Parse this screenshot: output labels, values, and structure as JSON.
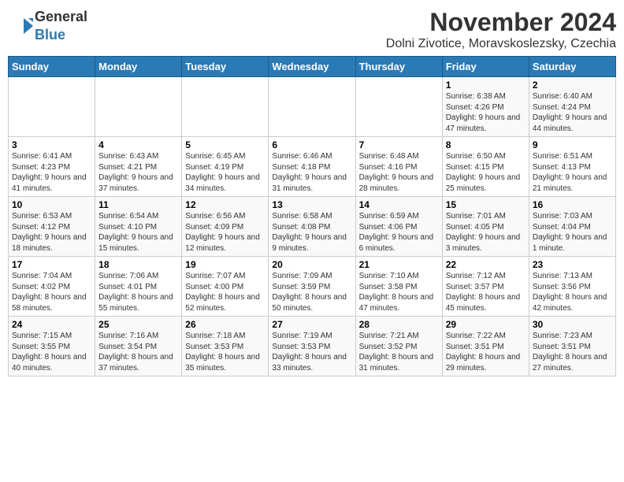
{
  "header": {
    "logo_general": "General",
    "logo_blue": "Blue",
    "title": "November 2024",
    "subtitle": "Dolni Zivotice, Moravskoslezsky, Czechia"
  },
  "days_of_week": [
    "Sunday",
    "Monday",
    "Tuesday",
    "Wednesday",
    "Thursday",
    "Friday",
    "Saturday"
  ],
  "weeks": [
    [
      {
        "day": "",
        "info": ""
      },
      {
        "day": "",
        "info": ""
      },
      {
        "day": "",
        "info": ""
      },
      {
        "day": "",
        "info": ""
      },
      {
        "day": "",
        "info": ""
      },
      {
        "day": "1",
        "info": "Sunrise: 6:38 AM\nSunset: 4:26 PM\nDaylight: 9 hours and 47 minutes."
      },
      {
        "day": "2",
        "info": "Sunrise: 6:40 AM\nSunset: 4:24 PM\nDaylight: 9 hours and 44 minutes."
      }
    ],
    [
      {
        "day": "3",
        "info": "Sunrise: 6:41 AM\nSunset: 4:23 PM\nDaylight: 9 hours and 41 minutes."
      },
      {
        "day": "4",
        "info": "Sunrise: 6:43 AM\nSunset: 4:21 PM\nDaylight: 9 hours and 37 minutes."
      },
      {
        "day": "5",
        "info": "Sunrise: 6:45 AM\nSunset: 4:19 PM\nDaylight: 9 hours and 34 minutes."
      },
      {
        "day": "6",
        "info": "Sunrise: 6:46 AM\nSunset: 4:18 PM\nDaylight: 9 hours and 31 minutes."
      },
      {
        "day": "7",
        "info": "Sunrise: 6:48 AM\nSunset: 4:16 PM\nDaylight: 9 hours and 28 minutes."
      },
      {
        "day": "8",
        "info": "Sunrise: 6:50 AM\nSunset: 4:15 PM\nDaylight: 9 hours and 25 minutes."
      },
      {
        "day": "9",
        "info": "Sunrise: 6:51 AM\nSunset: 4:13 PM\nDaylight: 9 hours and 21 minutes."
      }
    ],
    [
      {
        "day": "10",
        "info": "Sunrise: 6:53 AM\nSunset: 4:12 PM\nDaylight: 9 hours and 18 minutes."
      },
      {
        "day": "11",
        "info": "Sunrise: 6:54 AM\nSunset: 4:10 PM\nDaylight: 9 hours and 15 minutes."
      },
      {
        "day": "12",
        "info": "Sunrise: 6:56 AM\nSunset: 4:09 PM\nDaylight: 9 hours and 12 minutes."
      },
      {
        "day": "13",
        "info": "Sunrise: 6:58 AM\nSunset: 4:08 PM\nDaylight: 9 hours and 9 minutes."
      },
      {
        "day": "14",
        "info": "Sunrise: 6:59 AM\nSunset: 4:06 PM\nDaylight: 9 hours and 6 minutes."
      },
      {
        "day": "15",
        "info": "Sunrise: 7:01 AM\nSunset: 4:05 PM\nDaylight: 9 hours and 3 minutes."
      },
      {
        "day": "16",
        "info": "Sunrise: 7:03 AM\nSunset: 4:04 PM\nDaylight: 9 hours and 1 minute."
      }
    ],
    [
      {
        "day": "17",
        "info": "Sunrise: 7:04 AM\nSunset: 4:02 PM\nDaylight: 8 hours and 58 minutes."
      },
      {
        "day": "18",
        "info": "Sunrise: 7:06 AM\nSunset: 4:01 PM\nDaylight: 8 hours and 55 minutes."
      },
      {
        "day": "19",
        "info": "Sunrise: 7:07 AM\nSunset: 4:00 PM\nDaylight: 8 hours and 52 minutes."
      },
      {
        "day": "20",
        "info": "Sunrise: 7:09 AM\nSunset: 3:59 PM\nDaylight: 8 hours and 50 minutes."
      },
      {
        "day": "21",
        "info": "Sunrise: 7:10 AM\nSunset: 3:58 PM\nDaylight: 8 hours and 47 minutes."
      },
      {
        "day": "22",
        "info": "Sunrise: 7:12 AM\nSunset: 3:57 PM\nDaylight: 8 hours and 45 minutes."
      },
      {
        "day": "23",
        "info": "Sunrise: 7:13 AM\nSunset: 3:56 PM\nDaylight: 8 hours and 42 minutes."
      }
    ],
    [
      {
        "day": "24",
        "info": "Sunrise: 7:15 AM\nSunset: 3:55 PM\nDaylight: 8 hours and 40 minutes."
      },
      {
        "day": "25",
        "info": "Sunrise: 7:16 AM\nSunset: 3:54 PM\nDaylight: 8 hours and 37 minutes."
      },
      {
        "day": "26",
        "info": "Sunrise: 7:18 AM\nSunset: 3:53 PM\nDaylight: 8 hours and 35 minutes."
      },
      {
        "day": "27",
        "info": "Sunrise: 7:19 AM\nSunset: 3:53 PM\nDaylight: 8 hours and 33 minutes."
      },
      {
        "day": "28",
        "info": "Sunrise: 7:21 AM\nSunset: 3:52 PM\nDaylight: 8 hours and 31 minutes."
      },
      {
        "day": "29",
        "info": "Sunrise: 7:22 AM\nSunset: 3:51 PM\nDaylight: 8 hours and 29 minutes."
      },
      {
        "day": "30",
        "info": "Sunrise: 7:23 AM\nSunset: 3:51 PM\nDaylight: 8 hours and 27 minutes."
      }
    ]
  ]
}
